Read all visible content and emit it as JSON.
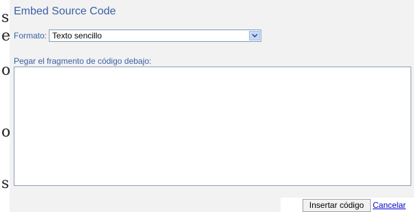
{
  "background_fragments": [
    "s",
    "e",
    "o",
    "o",
    "s"
  ],
  "dialog": {
    "title": "Embed Source Code",
    "format_label": "Formato:",
    "format_value": "Texto sencillo",
    "code_label": "Pegar el fragmento de código debajo:",
    "code_value": "",
    "insert_button_label": "Insertar código",
    "cancel_link_label": "Cancelar"
  },
  "icons": {
    "dropdown": "chevron-down-icon"
  },
  "colors": {
    "label_blue": "#3a5fa6",
    "link_blue": "#0000cc",
    "panel_bg": "#f2f2f2"
  }
}
